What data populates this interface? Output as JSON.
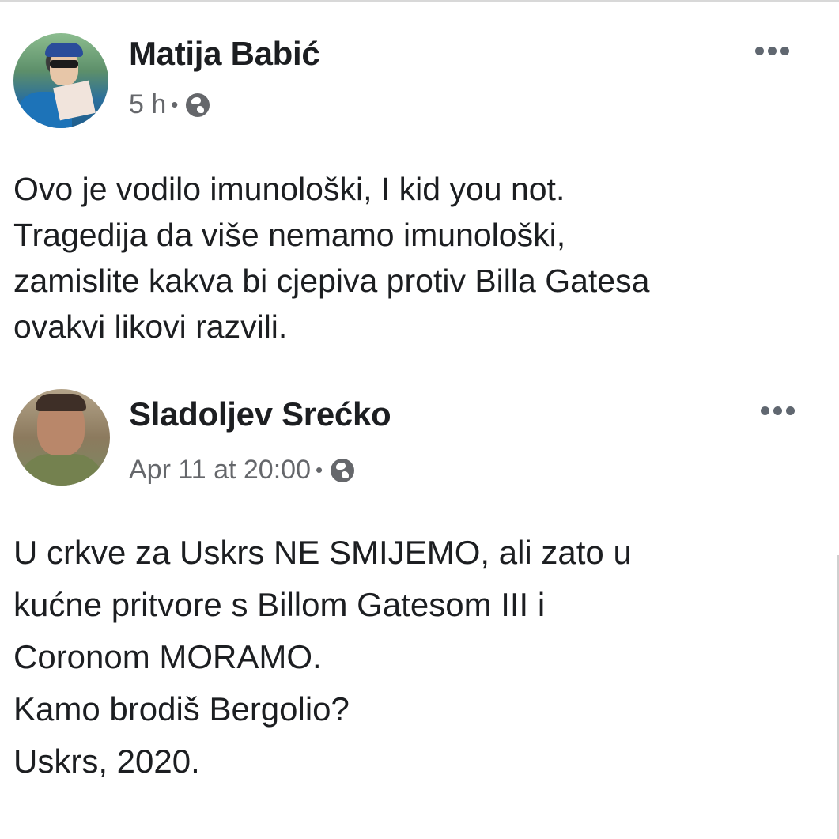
{
  "post": {
    "author": "Matija Babić",
    "time": "5 h",
    "separator": "•",
    "privacy_icon": "globe-icon",
    "menu_icon": "more-options-icon",
    "text": "Ovo je vodilo imunološki, I kid you not.\nTragedija da više nemamo imunološki,\nzamislite kakva bi cjepiva protiv Billa Gatesa\novakvi likovi razvili."
  },
  "shared_post": {
    "author": "Sladoljev Srećko",
    "time": "Apr 11 at 20:00",
    "separator": "•",
    "privacy_icon": "globe-icon",
    "menu_icon": "more-options-icon",
    "text": "U crkve za Uskrs NE SMIJEMO, ali zato u\nkućne pritvore s Billom Gatesom III i\nCoronom MORAMO.\nKamo brodiš Bergolio?\nUskrs, 2020."
  },
  "colors": {
    "text_primary": "#1c1e21",
    "text_secondary": "#65676b",
    "icon": "#606770"
  }
}
